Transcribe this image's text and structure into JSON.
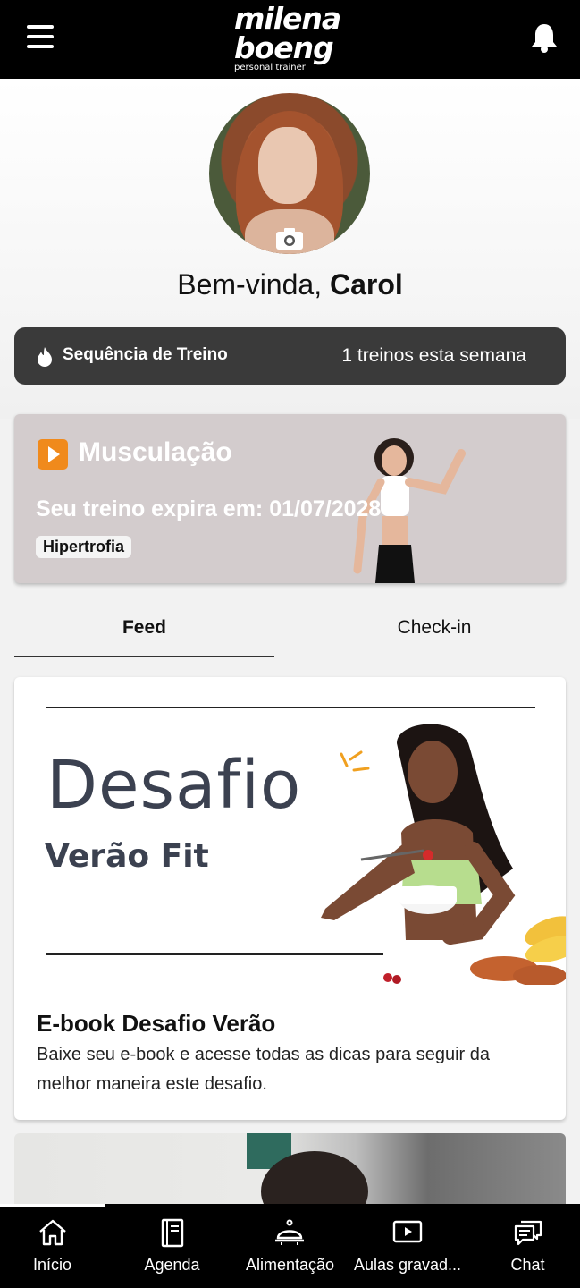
{
  "header": {
    "brand_line1": "milena",
    "brand_line2": "boeng",
    "brand_tagline": "personal trainer",
    "menu_icon": "hamburger-menu-icon",
    "notification_icon": "bell-icon"
  },
  "profile": {
    "greeting": "Bem-vinda, ",
    "name": "Carol",
    "photo_action_icon": "camera-icon"
  },
  "streak": {
    "icon": "flame-icon",
    "label": "Sequência de Treino",
    "count_text": "1 treinos esta semana"
  },
  "workout": {
    "icon": "play-icon",
    "title": "Musculação",
    "expiry": "Seu treino expira em: 01/07/2028",
    "tag": "Hipertrofia"
  },
  "tabs": [
    {
      "label": "Feed",
      "active": true
    },
    {
      "label": "Check-in",
      "active": false
    }
  ],
  "feed": {
    "post1": {
      "banner_title": "Desafio",
      "banner_subtitle": "Verão Fit",
      "title": "E-book Desafio Verão",
      "description": "Baixe seu e-book e acesse todas as dicas para seguir da melhor maneira este desafio."
    }
  },
  "bottom_nav": [
    {
      "label": "Início",
      "icon": "home-icon",
      "active": true
    },
    {
      "label": "Agenda",
      "icon": "agenda-book-icon",
      "active": false
    },
    {
      "label": "Alimentação",
      "icon": "food-cloche-icon",
      "active": false
    },
    {
      "label": "Aulas gravad...",
      "icon": "video-play-icon",
      "active": false
    },
    {
      "label": "Chat",
      "icon": "chat-bubbles-icon",
      "active": false
    }
  ],
  "colors": {
    "header_bg": "#000000",
    "streak_bg": "#3a3a3a",
    "workout_bg": "#d3cccd",
    "accent_orange": "#f08a1c",
    "banner_text": "#3b4150"
  }
}
